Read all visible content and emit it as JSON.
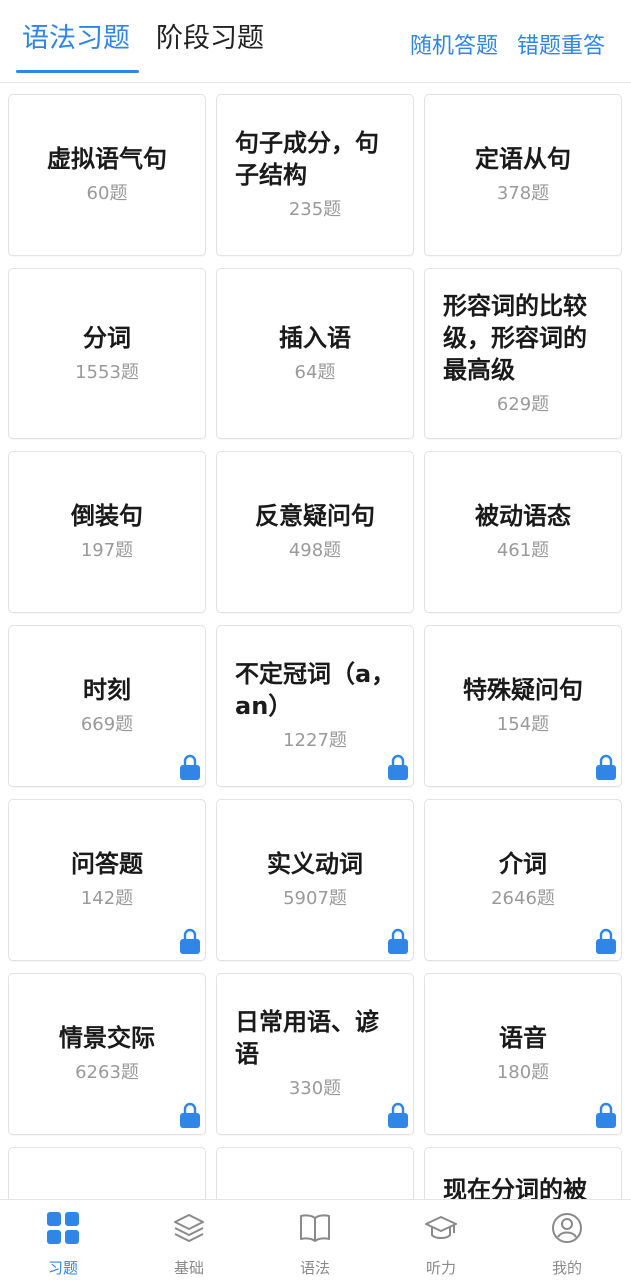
{
  "header": {
    "tabs": [
      {
        "label": "语法习题",
        "active": true
      },
      {
        "label": "阶段习题",
        "active": false
      }
    ],
    "actions": {
      "random": "随机答题",
      "wrong": "错题重答"
    }
  },
  "colors": {
    "accent": "#2f86e6",
    "lock": "#2f86e6"
  },
  "cards": [
    {
      "title": "虚拟语气句",
      "count": "60题",
      "locked": false
    },
    {
      "title": "句子成分，句子结构",
      "count": "235题",
      "locked": false
    },
    {
      "title": "定语从句",
      "count": "378题",
      "locked": false
    },
    {
      "title": "分词",
      "count": "1553题",
      "locked": false
    },
    {
      "title": "插入语",
      "count": "64题",
      "locked": false
    },
    {
      "title": "形容词的比较级，形容词的最高级",
      "count": "629题",
      "locked": false
    },
    {
      "title": "倒装句",
      "count": "197题",
      "locked": false
    },
    {
      "title": "反意疑问句",
      "count": "498题",
      "locked": false
    },
    {
      "title": "被动语态",
      "count": "461题",
      "locked": false
    },
    {
      "title": "时刻",
      "count": "669题",
      "locked": true
    },
    {
      "title": "不定冠词（a，an）",
      "count": "1227题",
      "locked": true
    },
    {
      "title": "特殊疑问句",
      "count": "154题",
      "locked": true
    },
    {
      "title": "问答题",
      "count": "142题",
      "locked": true
    },
    {
      "title": "实义动词",
      "count": "5907题",
      "locked": true
    },
    {
      "title": "介词",
      "count": "2646题",
      "locked": true
    },
    {
      "title": "情景交际",
      "count": "6263题",
      "locked": true
    },
    {
      "title": "日常用语、谚语",
      "count": "330题",
      "locked": true
    },
    {
      "title": "语音",
      "count": "180题",
      "locked": true
    },
    {
      "title": "",
      "count": "",
      "locked": false
    },
    {
      "title": "",
      "count": "",
      "locked": false
    },
    {
      "title": "现在分词的被",
      "count": "",
      "locked": false
    }
  ],
  "bottom_nav": [
    {
      "label": "习题",
      "icon": "grid-icon",
      "active": true
    },
    {
      "label": "基础",
      "icon": "layers-icon",
      "active": false
    },
    {
      "label": "语法",
      "icon": "book-icon",
      "active": false
    },
    {
      "label": "听力",
      "icon": "graduation-cap-icon",
      "active": false
    },
    {
      "label": "我的",
      "icon": "user-icon",
      "active": false
    }
  ]
}
